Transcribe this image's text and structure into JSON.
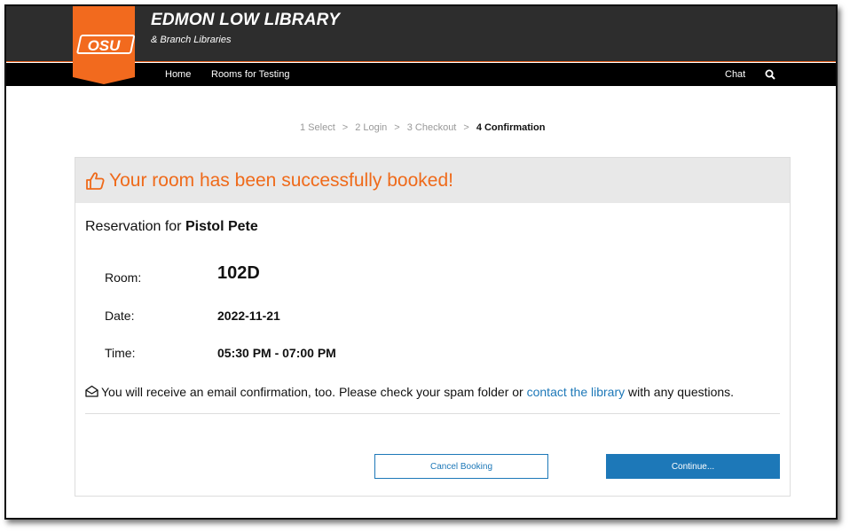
{
  "header": {
    "logo_text": "OSU",
    "title": "EDMON LOW LIBRARY",
    "subtitle": "& Branch Libraries",
    "nav": {
      "home": "Home",
      "rooms": "Rooms for Testing",
      "chat": "Chat",
      "search_icon": "search-icon"
    },
    "colors": {
      "brand_orange": "#ef6a1a",
      "topbar": "#2d2d2d",
      "navbar": "#000000"
    }
  },
  "steps": [
    {
      "label": "1 Select",
      "active": false
    },
    {
      "label": "2 Login",
      "active": false
    },
    {
      "label": "3 Checkout",
      "active": false
    },
    {
      "label": "4 Confirmation",
      "active": true
    }
  ],
  "steps_separator": ">",
  "confirmation": {
    "message": "Your room has been successfully booked!",
    "icon": "thumbs-up-icon",
    "reservation_prefix": "Reservation for",
    "reservation_name": "Pistol Pete",
    "fields": {
      "room_label": "Room:",
      "room_value": "102D",
      "date_label": "Date:",
      "date_value": "2022-11-21",
      "time_label": "Time:",
      "time_value": "05:30 PM - 07:00 PM"
    },
    "email_note": {
      "before": "You will receive an email confirmation, too. Please check your spam folder or",
      "link": "contact the library",
      "after": "with any questions.",
      "icon": "envelope-open-icon"
    },
    "buttons": {
      "cancel": "Cancel Booking",
      "continue": "Continue..."
    },
    "colors": {
      "link_blue": "#1d78b8",
      "header_bg": "#e8e8e8"
    }
  }
}
